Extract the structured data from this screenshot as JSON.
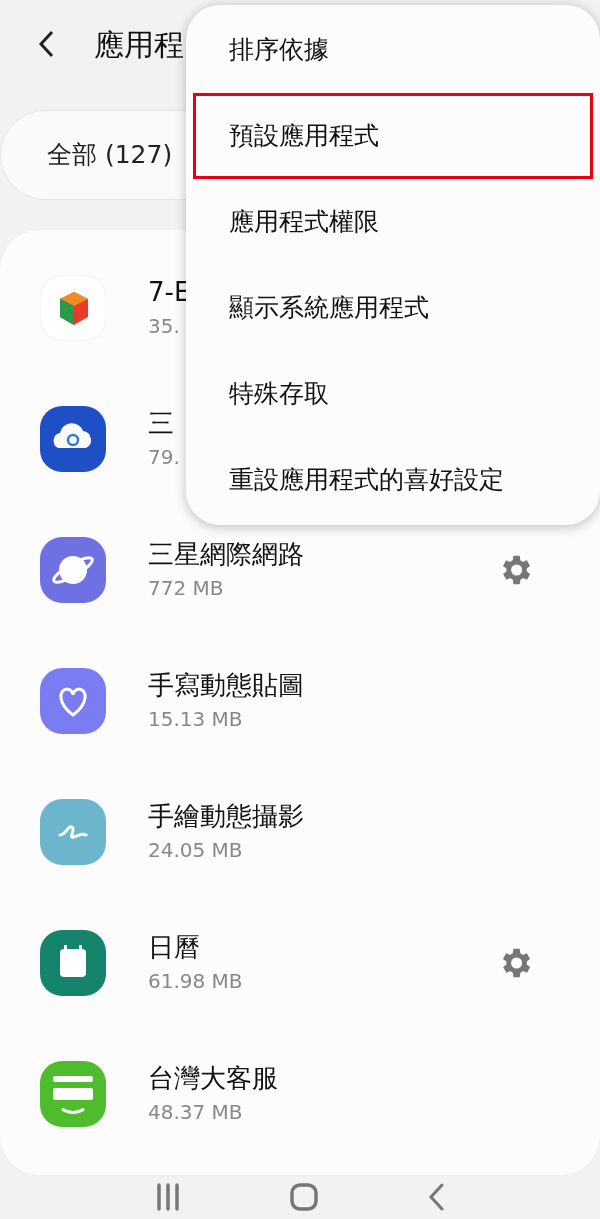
{
  "header": {
    "title": "應用程"
  },
  "filter": {
    "label": "全部 (127)"
  },
  "apps": [
    {
      "kind": "store",
      "name": "7-E",
      "size": "35."
    },
    {
      "kind": "cloud",
      "name": "三",
      "size": "79."
    },
    {
      "kind": "planet",
      "name": "三星網際網路",
      "size": "772 MB",
      "settings": true
    },
    {
      "kind": "heart",
      "name": "手寫動態貼圖",
      "size": "15.13 MB",
      "settings": false
    },
    {
      "kind": "squiggle",
      "name": "手繪動態攝影",
      "size": "24.05 MB",
      "settings": false
    },
    {
      "kind": "calendar",
      "name": "日曆",
      "size": "61.98 MB",
      "settings": true
    },
    {
      "kind": "chat",
      "name": "台灣大客服",
      "size": "48.37 MB",
      "settings": false
    }
  ],
  "menu": [
    {
      "label": "排序依據",
      "highlighted": false
    },
    {
      "label": "預設應用程式",
      "highlighted": true
    },
    {
      "label": "應用程式權限",
      "highlighted": false
    },
    {
      "label": "顯示系統應用程式",
      "highlighted": false
    },
    {
      "label": "特殊存取",
      "highlighted": false
    },
    {
      "label": "重設應用程式的喜好設定",
      "highlighted": false
    }
  ]
}
